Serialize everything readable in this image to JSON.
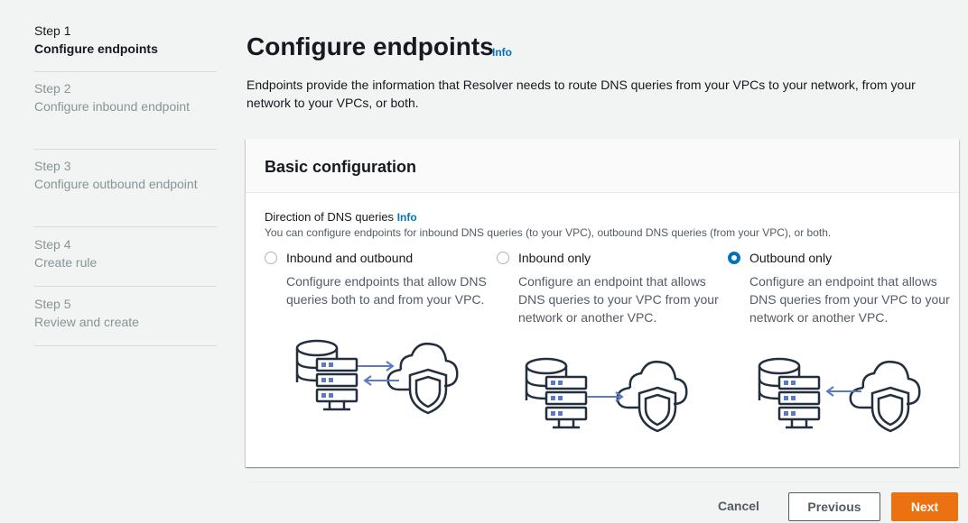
{
  "sidebar": {
    "steps": [
      {
        "num": "Step 1",
        "title": "Configure endpoints",
        "active": true
      },
      {
        "num": "Step 2",
        "title": "Configure inbound endpoint",
        "active": false
      },
      {
        "num": "Step 3",
        "title": "Configure outbound endpoint",
        "active": false
      },
      {
        "num": "Step 4",
        "title": "Create rule",
        "active": false
      },
      {
        "num": "Step 5",
        "title": "Review and create",
        "active": false
      }
    ]
  },
  "main": {
    "title": "Configure endpoints",
    "info_label": "Info",
    "description": "Endpoints provide the information that Resolver needs to route DNS queries from your VPCs to your network, from your network to your VPCs, or both.",
    "panel": {
      "title": "Basic configuration",
      "field_label": "Direction of DNS queries",
      "field_info": "Info",
      "field_description": "You can configure endpoints for inbound DNS queries (to your VPC), outbound DNS queries (from your VPC), or both.",
      "options": [
        {
          "label": "Inbound and outbound",
          "description": "Configure endpoints that allow DNS queries both to and from your VPC.",
          "selected": false
        },
        {
          "label": "Inbound only",
          "description": "Configure an endpoint that allows DNS queries to your VPC from your network or another VPC.",
          "selected": false
        },
        {
          "label": "Outbound only",
          "description": "Configure an endpoint that allows DNS queries from your VPC to your network or another VPC.",
          "selected": true
        }
      ]
    }
  },
  "footer": {
    "cancel_label": "Cancel",
    "previous_label": "Previous",
    "next_label": "Next"
  },
  "colors": {
    "accent": "#0073bb",
    "primary_button": "#ec7211",
    "illustration_stroke": "#232f3e",
    "illustration_arrow": "#5a7bc4",
    "illustration_fill": "#5a7bc4"
  }
}
